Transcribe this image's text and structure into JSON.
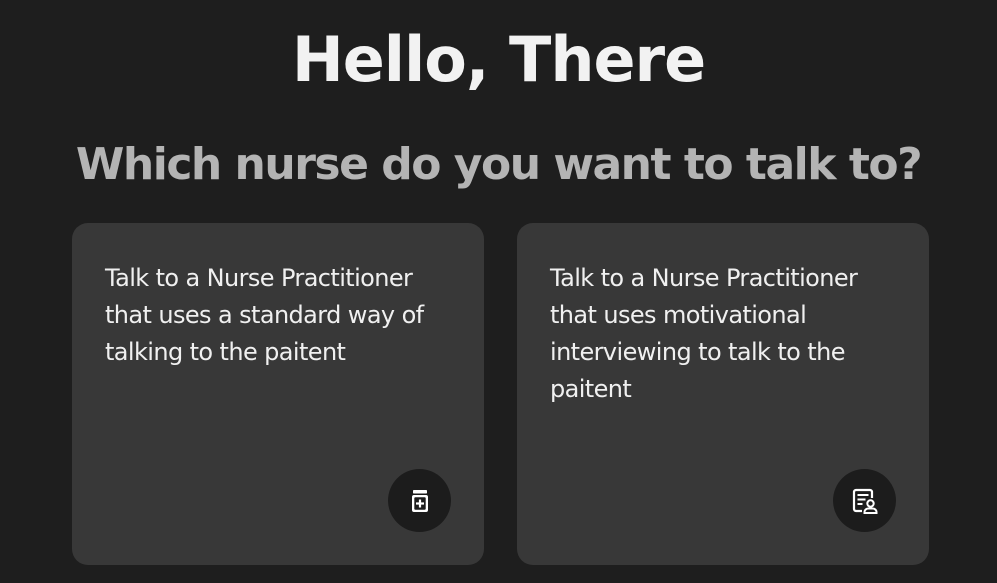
{
  "header": {
    "greeting": "Hello, There",
    "question": "Which nurse do you want to talk to?"
  },
  "cards": [
    {
      "text": "Talk to a Nurse Practitioner that uses a standard way of talking to the paitent",
      "icon": "medicine-bottle-icon"
    },
    {
      "text": "Talk to a Nurse Practitioner that uses motivational interviewing to talk to the paitent",
      "icon": "clipboard-person-icon"
    }
  ],
  "colors": {
    "background": "#1e1e1e",
    "card": "#383838",
    "icon_circle": "#1c1c1c",
    "greeting": "#f2f2f2",
    "question": "#b4b4b4"
  }
}
